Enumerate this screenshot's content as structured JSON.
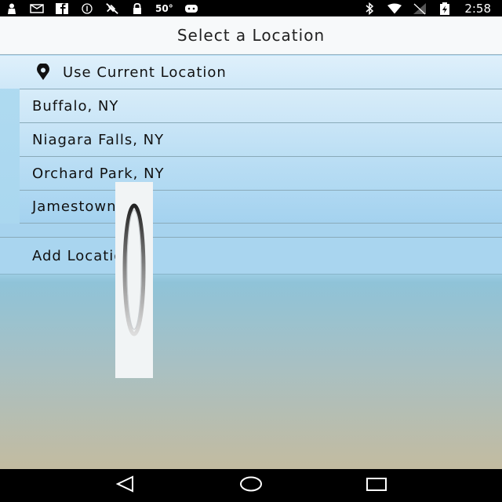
{
  "status_bar": {
    "temperature": "50°",
    "time": "2:58"
  },
  "header": {
    "title": "Select a Location"
  },
  "current_location": {
    "label": "Use Current Location"
  },
  "locations": [
    {
      "label": "Buffalo, NY"
    },
    {
      "label": "Niagara Falls, NY"
    },
    {
      "label": "Orchard Park, NY"
    },
    {
      "label": "Jamestown, NY"
    }
  ],
  "add_location": {
    "label": "Add Location"
  },
  "icons": {
    "status_left": [
      "person-icon",
      "mail-icon",
      "facebook-icon",
      "info-icon",
      "no-satellite-icon",
      "lock-icon",
      "android-icon"
    ],
    "status_right": [
      "bluetooth-icon",
      "wifi-icon",
      "signal-icon",
      "battery-charging-icon"
    ],
    "location": "location-pin-icon",
    "nav": [
      "back-icon",
      "home-icon",
      "recents-icon"
    ]
  }
}
